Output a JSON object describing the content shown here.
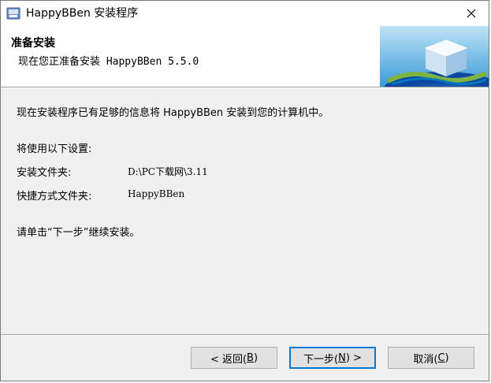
{
  "window": {
    "title": "HappyBBen 安装程序"
  },
  "header": {
    "title": "准备安装",
    "subtitle": "现在您正准备安装 HappyBBen 5.5.0"
  },
  "content": {
    "intro": "现在安装程序已有足够的信息将 HappyBBen 安装到您的计算机中。",
    "settings_heading": "将使用以下设置:",
    "settings": [
      {
        "label": "安装文件夹:",
        "value": "D:\\PC下载网\\3.11"
      },
      {
        "label": "快捷方式文件夹:",
        "value": "HappyBBen"
      }
    ],
    "instruction": "请单击“下一步”继续安装。"
  },
  "buttons": {
    "back": {
      "pre": "< 返回(",
      "key": "B",
      "post": ")"
    },
    "next": {
      "pre": "下一步(",
      "key": "N",
      "post": ") >"
    },
    "cancel": {
      "pre": "取消(",
      "key": "C",
      "post": ")"
    }
  },
  "icons": {
    "app": "installer-app-icon",
    "close": "close-icon",
    "header": "setup-cube-banner"
  },
  "colors": {
    "default_button_border": "#0078d7",
    "dialog_background": "#f0f0f0"
  }
}
